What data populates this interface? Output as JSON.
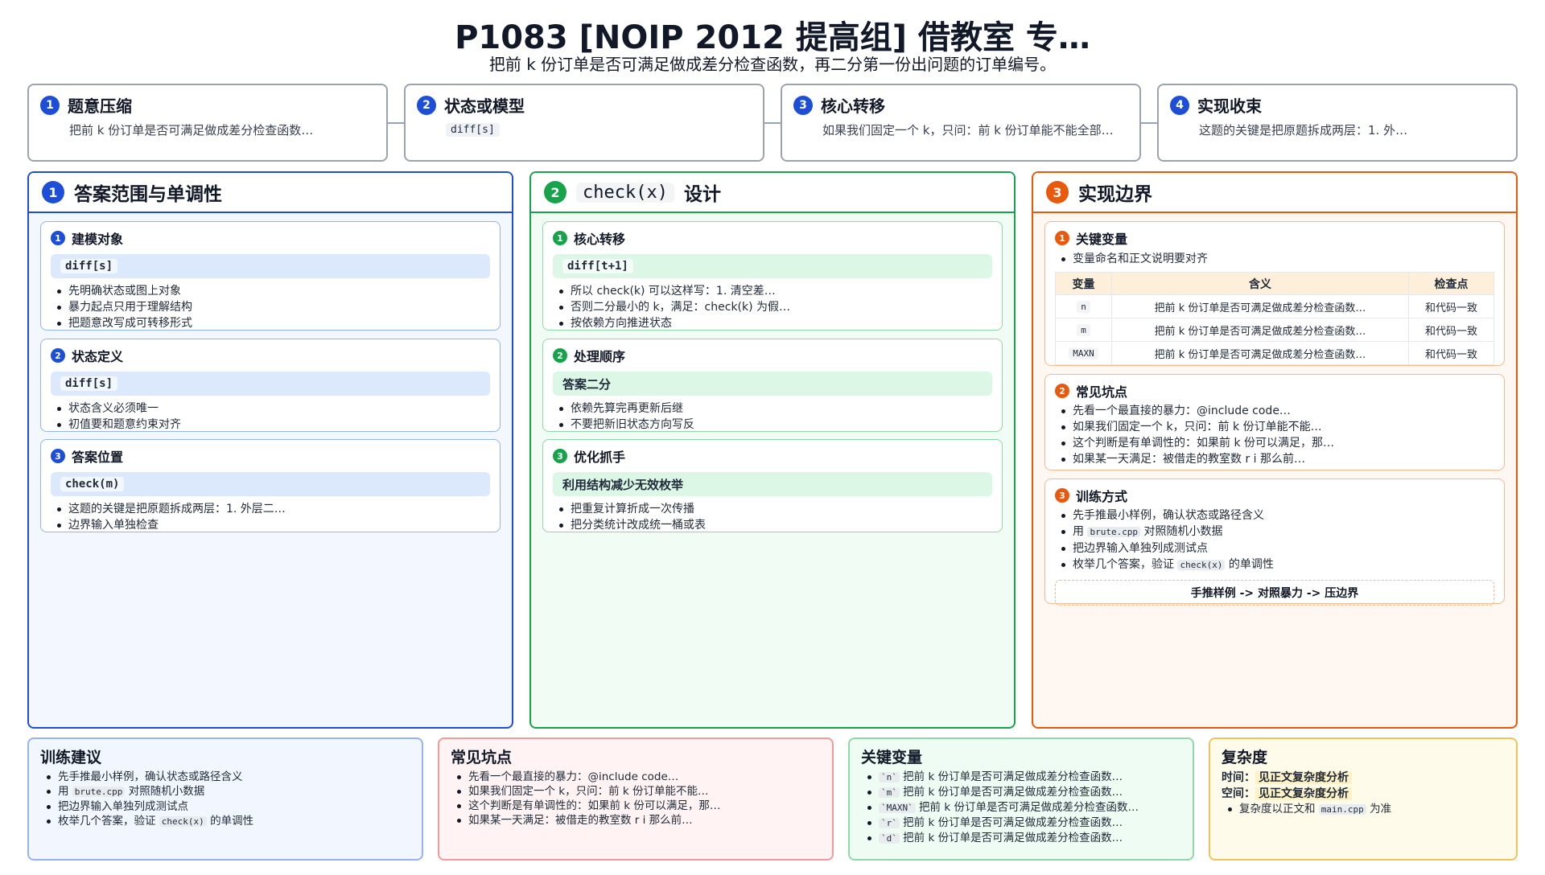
{
  "header": {
    "title": "P1083 [NOIP 2012 提高组] 借教室 专…",
    "subtitle": "把前 k 份订单是否可满足做成差分检查函数，再二分第一份出问题的订单编号。"
  },
  "steps": [
    {
      "num": "1",
      "title": "题意压缩",
      "text": "把前 k 份订单是否可满足做成差分检查函数…",
      "chip": ""
    },
    {
      "num": "2",
      "title": "状态或模型",
      "text": "",
      "chip": "diff[s]"
    },
    {
      "num": "3",
      "title": "核心转移",
      "text": "如果我们固定一个 k，只问：前 k 份订单能不能全部…",
      "chip": ""
    },
    {
      "num": "4",
      "title": "实现收束",
      "text": "这题的关键是把原题拆成两层：1. 外…",
      "chip": ""
    }
  ],
  "columns": {
    "blue": {
      "num": "1",
      "title": "答案范围与单调性",
      "cards": [
        {
          "num": "1",
          "title": "建模对象",
          "band": "diff[s]",
          "items": [
            "先明确状态或图上对象",
            "暴力起点只用于理解结构",
            "把题意改写成可转移形式"
          ]
        },
        {
          "num": "2",
          "title": "状态定义",
          "band": "diff[s]",
          "items": [
            "状态含义必须唯一",
            "初值要和题意约束对齐"
          ]
        },
        {
          "num": "3",
          "title": "答案位置",
          "band": "check(m)",
          "items": [
            "这题的关键是把原题拆成两层：1. 外层二…",
            "边界输入单独检查"
          ]
        }
      ]
    },
    "green": {
      "num": "2",
      "title_code": "check(x)",
      "title_rest": "设计",
      "cards": [
        {
          "num": "1",
          "title": "核心转移",
          "band": "diff[t+1]",
          "items": [
            "所以 check(k) 可以这样写：1. 清空差…",
            "否则二分最小的 k，满足：check(k) 为假…",
            "按依赖方向推进状态"
          ]
        },
        {
          "num": "2",
          "title": "处理顺序",
          "band": "答案二分",
          "items": [
            "依赖先算完再更新后继",
            "不要把新旧状态方向写反"
          ]
        },
        {
          "num": "3",
          "title": "优化抓手",
          "band": "利用结构减少无效枚举",
          "items": [
            "把重复计算折成一次传播",
            "把分类统计改成统一桶或表"
          ]
        }
      ]
    },
    "orange": {
      "num": "3",
      "title": "实现边界",
      "vars_card": {
        "num": "1",
        "title": "关键变量",
        "note": "变量命名和正文说明要对齐",
        "headers": [
          "变量",
          "含义",
          "检查点"
        ],
        "rows": [
          {
            "var": "n",
            "meaning": "把前 k 份订单是否可满足做成差分检查函数…",
            "check": "和代码一致"
          },
          {
            "var": "m",
            "meaning": "把前 k 份订单是否可满足做成差分检查函数…",
            "check": "和代码一致"
          },
          {
            "var": "MAXN",
            "meaning": "把前 k 份订单是否可满足做成差分检查函数…",
            "check": "和代码一致"
          }
        ]
      },
      "pitfall_card": {
        "num": "2",
        "title": "常见坑点",
        "items": [
          "先看一个最直接的暴力：@include code…",
          "如果我们固定一个 k，只问：前 k 份订单能不能…",
          "这个判断是有单调性的：如果前 k 份可以满足，那…",
          "如果某一天满足：被借走的教室数 r i 那么前…"
        ]
      },
      "train_card": {
        "num": "3",
        "title": "训练方式",
        "item1": "先手推最小样例，确认状态或路径含义",
        "item2_pre": "用",
        "item2_code": "brute.cpp",
        "item2_post": "对照随机小数据",
        "item3": "把边界输入单独列成测试点",
        "item4_pre": "枚举几个答案，验证",
        "item4_code": "check(x)",
        "item4_post": "的单调性",
        "flow": "手推样例 -> 对照暴力 -> 压边界"
      }
    }
  },
  "bottom": {
    "train": {
      "title": "训练建议",
      "item1": "先手推最小样例，确认状态或路径含义",
      "item2_pre": "用",
      "item2_code": "brute.cpp",
      "item2_post": "对照随机小数据",
      "item3": "把边界输入单独列成测试点",
      "item4_pre": "枚举几个答案，验证",
      "item4_code": "check(x)",
      "item4_post": "的单调性"
    },
    "pitfalls": {
      "title": "常见坑点",
      "items": [
        "先看一个最直接的暴力：@include code…",
        "如果我们固定一个 k，只问：前 k 份订单能不能…",
        "这个判断是有单调性的：如果前 k 份可以满足，那…",
        "如果某一天满足：被借走的教室数 r i 那么前…"
      ]
    },
    "vars": {
      "title": "关键变量",
      "items": [
        {
          "code": "`n`",
          "text": "把前 k 份订单是否可满足做成差分检查函数…"
        },
        {
          "code": "`m`",
          "text": "把前 k 份订单是否可满足做成差分检查函数…"
        },
        {
          "code": "`MAXN`",
          "text": "把前 k 份订单是否可满足做成差分检查函数…"
        },
        {
          "code": "`r`",
          "text": "把前 k 份订单是否可满足做成差分检查函数…"
        },
        {
          "code": "`d`",
          "text": "把前 k 份订单是否可满足做成差分检查函数…"
        }
      ]
    },
    "complexity": {
      "title": "复杂度",
      "time_label": "时间：",
      "time_value": "见正文复杂度分析",
      "space_label": "空间：",
      "space_value": "见正文复杂度分析",
      "note_pre": "复杂度以正文和",
      "note_code": "main.cpp",
      "note_post": "为准"
    }
  }
}
